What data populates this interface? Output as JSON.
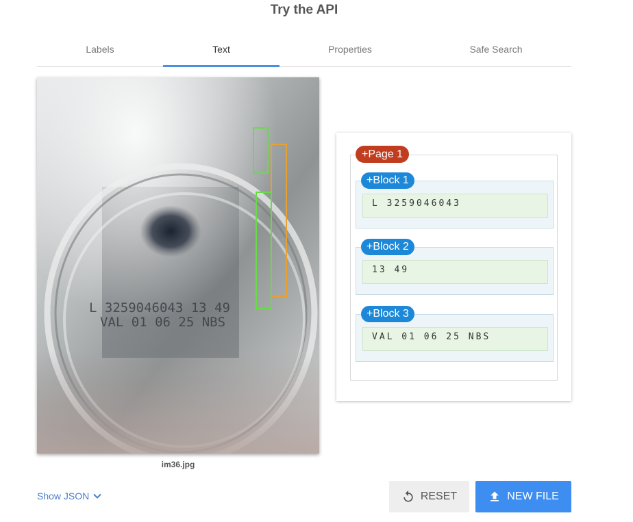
{
  "header": {
    "title": "Try the API"
  },
  "tabs": [
    {
      "label": "Labels",
      "active": false
    },
    {
      "label": "Text",
      "active": true
    },
    {
      "label": "Properties",
      "active": false
    },
    {
      "label": "Safe Search",
      "active": false
    }
  ],
  "image": {
    "filename": "im36.jpg",
    "printed_lines": [
      "L 3259046043  13 49",
      "VAL 01 06 25 NBS"
    ]
  },
  "results": {
    "page": {
      "label": "+Page 1"
    },
    "blocks": [
      {
        "label": "+Block 1",
        "text": "L 3259046043"
      },
      {
        "label": "+Block 2",
        "text": "13 49"
      },
      {
        "label": "+Block 3",
        "text": "VAL 01 06 25 NBS"
      }
    ]
  },
  "footer": {
    "show_json_label": "Show JSON",
    "reset_label": "RESET",
    "new_file_label": "NEW FILE"
  },
  "colors": {
    "accent": "#4a90e2",
    "page_badge": "#c03d20",
    "block_badge": "#1e88d8",
    "primary_button": "#3d8ef0",
    "box_green": "#66dd44",
    "box_orange": "#e8a030"
  },
  "icons": {
    "show_json": "chevron-down-icon",
    "reset": "refresh-icon",
    "new_file": "upload-icon"
  }
}
